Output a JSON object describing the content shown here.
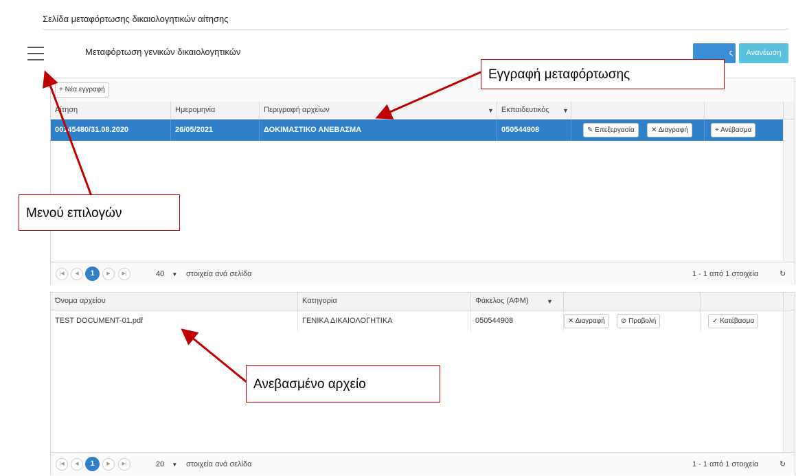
{
  "page": {
    "title": "Σελίδα μεταφόρτωσης δικαιολογητικών αίτησης"
  },
  "section": {
    "title": "Μεταφόρτωση γενικών δικαιολογητικών"
  },
  "buttons": {
    "blue_label": "ς",
    "refresh_label": "Ανανέωση"
  },
  "grid1": {
    "new_record_label": "+ Νέα εγγραφή",
    "columns": [
      "Αίτηση",
      "Ημερομηνία",
      "Περιγραφή αρχείων",
      "Εκπαιδευτικός"
    ],
    "rows": [
      {
        "application": "00145480/31.08.2020",
        "date": "26/05/2021",
        "description": "ΔΟΚΙΜΑΣΤΙΚΟ ΑΝΕΒΑΣΜΑ",
        "teacher": "050544908",
        "edit_label": "Επεξεργασία",
        "delete_label": "Διαγραφή",
        "upload_label": "Ανέβασμα"
      }
    ],
    "pager": {
      "current_page": "1",
      "page_size": "40",
      "per_page_label": "στοιχεία ανά σελίδα",
      "summary": "1 - 1 από 1 στοιχεία"
    }
  },
  "grid2": {
    "columns": [
      "Όνομα αρχείου",
      "Κατηγορία",
      "Φάκελος (ΑΦΜ)"
    ],
    "rows": [
      {
        "file_name": "TEST DOCUMENT-01.pdf",
        "category": "ΓΕΝΙΚΑ ΔΙΚΑΙΟΛΟΓΗΤΙΚΑ",
        "folder": "050544908",
        "delete_label": "Διαγραφή",
        "view_label": "Προβολή",
        "download_label": "Κατέβασμα"
      }
    ],
    "pager": {
      "current_page": "1",
      "page_size": "20",
      "per_page_label": "στοιχεία ανά σελίδα",
      "summary": "1 - 1 από 1 στοιχεία"
    }
  },
  "annotations": {
    "upload_record": "Εγγραφή μεταφόρτωσης",
    "options_menu": "Μενού επιλογών",
    "uploaded_file": "Ανεβασμένο αρχείο",
    "color": "#c00000"
  }
}
